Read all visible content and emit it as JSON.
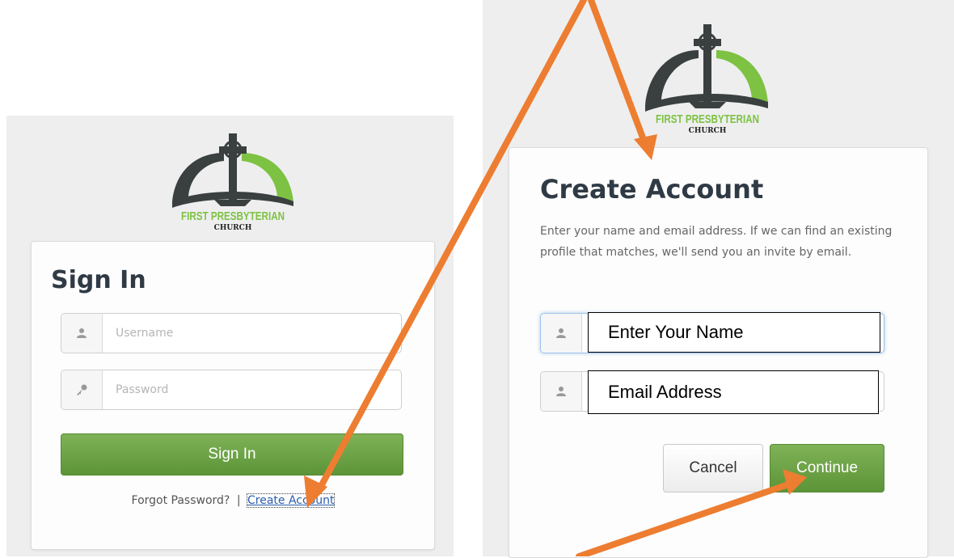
{
  "logo": {
    "name_line1": "FIRST PRESBYTERIAN",
    "name_line2": "CHURCH"
  },
  "signin": {
    "title": "Sign In",
    "username_placeholder": "Username",
    "password_placeholder": "Password",
    "signin_button": "Sign In",
    "forgot_link": "Forgot Password?",
    "separator": "|",
    "create_link": "Create Account"
  },
  "create": {
    "title": "Create Account",
    "description": "Enter your name and email address. If we can find an existing profile that matches, we'll send you an invite by email.",
    "name_overlay": "Enter Your Name",
    "email_overlay": "Email Address",
    "cancel_button": "Cancel",
    "continue_button": "Continue"
  },
  "colors": {
    "arrow": "#ed7d31",
    "green": "#6aa443",
    "logo_dark": "#3a3f3f",
    "logo_green": "#7dc243"
  }
}
